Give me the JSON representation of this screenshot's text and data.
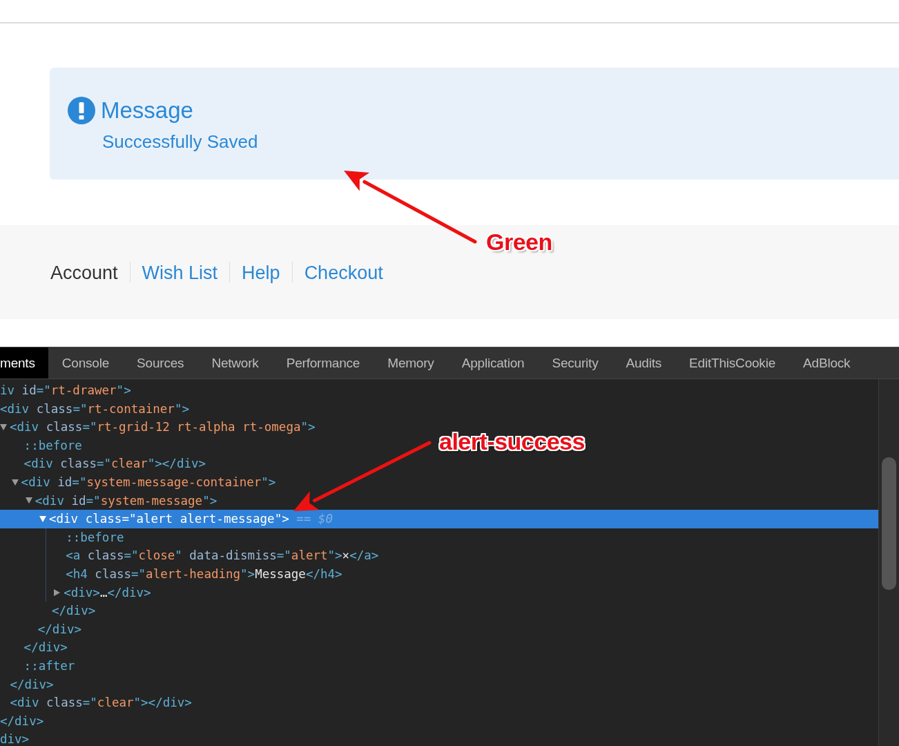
{
  "alert": {
    "heading": "Message",
    "body": "Successfully Saved"
  },
  "nav": [
    {
      "label": "Account",
      "kind": "plain"
    },
    {
      "label": "Wish List",
      "kind": "link"
    },
    {
      "label": "Help",
      "kind": "link"
    },
    {
      "label": "Checkout",
      "kind": "link"
    }
  ],
  "devtools": {
    "tabs": [
      {
        "label": "ments",
        "selected": true
      },
      {
        "label": "Console",
        "selected": false
      },
      {
        "label": "Sources",
        "selected": false
      },
      {
        "label": "Network",
        "selected": false
      },
      {
        "label": "Performance",
        "selected": false
      },
      {
        "label": "Memory",
        "selected": false
      },
      {
        "label": "Application",
        "selected": false
      },
      {
        "label": "Security",
        "selected": false
      },
      {
        "label": "Audits",
        "selected": false
      },
      {
        "label": "EditThisCookie",
        "selected": false
      },
      {
        "label": "AdBlock",
        "selected": false
      }
    ],
    "tree": [
      {
        "selected": false,
        "tokens": [
          {
            "kind": "tag",
            "text": "iv "
          },
          {
            "kind": "attr",
            "text": "id"
          },
          {
            "kind": "tag",
            "text": "=\""
          },
          {
            "kind": "value",
            "text": "rt-drawer"
          },
          {
            "kind": "tag",
            "text": "\">"
          }
        ],
        "close": [
          {
            "kind": "tag",
            "text": "div>"
          }
        ],
        "children": [
          {
            "selected": false,
            "tokens": [
              {
                "kind": "tag",
                "text": "<div "
              },
              {
                "kind": "attr",
                "text": "class"
              },
              {
                "kind": "tag",
                "text": "=\""
              },
              {
                "kind": "value",
                "text": "rt-container"
              },
              {
                "kind": "tag",
                "text": "\">"
              }
            ],
            "close": [
              {
                "kind": "tag",
                "text": "</div>"
              }
            ],
            "children": [
              {
                "selected": false,
                "expanded": true,
                "tokens": [
                  {
                    "kind": "tag",
                    "text": "<div "
                  },
                  {
                    "kind": "attr",
                    "text": "class"
                  },
                  {
                    "kind": "tag",
                    "text": "=\""
                  },
                  {
                    "kind": "value",
                    "text": "rt-grid-12 rt-alpha rt-omega"
                  },
                  {
                    "kind": "tag",
                    "text": "\">"
                  }
                ],
                "close": [
                  {
                    "kind": "tag",
                    "text": "</div>"
                  }
                ],
                "children": [
                  {
                    "selected": false,
                    "tokens": [
                      {
                        "kind": "tag",
                        "text": "::before"
                      }
                    ]
                  },
                  {
                    "selected": false,
                    "tokens": [
                      {
                        "kind": "tag",
                        "text": "<div "
                      },
                      {
                        "kind": "attr",
                        "text": "class"
                      },
                      {
                        "kind": "tag",
                        "text": "=\""
                      },
                      {
                        "kind": "value",
                        "text": "clear"
                      },
                      {
                        "kind": "tag",
                        "text": "\"></div>"
                      }
                    ]
                  },
                  {
                    "selected": false,
                    "expanded": true,
                    "tokens": [
                      {
                        "kind": "tag",
                        "text": "<div "
                      },
                      {
                        "kind": "attr",
                        "text": "id"
                      },
                      {
                        "kind": "tag",
                        "text": "=\""
                      },
                      {
                        "kind": "value",
                        "text": "system-message-container"
                      },
                      {
                        "kind": "tag",
                        "text": "\">"
                      }
                    ],
                    "close": [
                      {
                        "kind": "tag",
                        "text": "</div>"
                      }
                    ],
                    "children": [
                      {
                        "selected": false,
                        "expanded": true,
                        "tokens": [
                          {
                            "kind": "tag",
                            "text": "<div "
                          },
                          {
                            "kind": "attr",
                            "text": "id"
                          },
                          {
                            "kind": "tag",
                            "text": "=\""
                          },
                          {
                            "kind": "value",
                            "text": "system-message"
                          },
                          {
                            "kind": "tag",
                            "text": "\">"
                          }
                        ],
                        "close": [
                          {
                            "kind": "tag",
                            "text": "</div>"
                          }
                        ],
                        "children": [
                          {
                            "selected": true,
                            "expanded": true,
                            "tokens": [
                              {
                                "kind": "tag",
                                "text": "<div "
                              },
                              {
                                "kind": "attr",
                                "text": "class"
                              },
                              {
                                "kind": "tag",
                                "text": "=\""
                              },
                              {
                                "kind": "value",
                                "text": "alert alert-message"
                              },
                              {
                                "kind": "tag",
                                "text": "\">"
                              },
                              {
                                "kind": "dim",
                                "text": " == $0"
                              }
                            ],
                            "close": [
                              {
                                "kind": "tag",
                                "text": "</div>"
                              }
                            ],
                            "children": [
                              {
                                "selected": false,
                                "tokens": [
                                  {
                                    "kind": "tag",
                                    "text": "::before"
                                  }
                                ]
                              },
                              {
                                "selected": false,
                                "tokens": [
                                  {
                                    "kind": "tag",
                                    "text": "<a "
                                  },
                                  {
                                    "kind": "attr",
                                    "text": "class"
                                  },
                                  {
                                    "kind": "tag",
                                    "text": "=\""
                                  },
                                  {
                                    "kind": "value",
                                    "text": "close"
                                  },
                                  {
                                    "kind": "tag",
                                    "text": "\" "
                                  },
                                  {
                                    "kind": "attr",
                                    "text": "data-dismiss"
                                  },
                                  {
                                    "kind": "tag",
                                    "text": "=\""
                                  },
                                  {
                                    "kind": "value",
                                    "text": "alert"
                                  },
                                  {
                                    "kind": "tag",
                                    "text": "\">"
                                  },
                                  {
                                    "kind": "text",
                                    "text": "×"
                                  },
                                  {
                                    "kind": "tag",
                                    "text": "</a>"
                                  }
                                ]
                              },
                              {
                                "selected": false,
                                "tokens": [
                                  {
                                    "kind": "tag",
                                    "text": "<h4 "
                                  },
                                  {
                                    "kind": "attr",
                                    "text": "class"
                                  },
                                  {
                                    "kind": "tag",
                                    "text": "=\""
                                  },
                                  {
                                    "kind": "value",
                                    "text": "alert-heading"
                                  },
                                  {
                                    "kind": "tag",
                                    "text": "\">"
                                  },
                                  {
                                    "kind": "text",
                                    "text": "Message"
                                  },
                                  {
                                    "kind": "tag",
                                    "text": "</h4>"
                                  }
                                ]
                              },
                              {
                                "selected": false,
                                "expanded": false,
                                "tokens": [
                                  {
                                    "kind": "tag",
                                    "text": "<div>"
                                  },
                                  {
                                    "kind": "text",
                                    "text": "…"
                                  },
                                  {
                                    "kind": "tag",
                                    "text": "</div>"
                                  }
                                ]
                              }
                            ]
                          }
                        ]
                      }
                    ]
                  },
                  {
                    "selected": false,
                    "tokens": [
                      {
                        "kind": "tag",
                        "text": "::after"
                      }
                    ]
                  }
                ]
              },
              {
                "selected": false,
                "tokens": [
                  {
                    "kind": "tag",
                    "text": "<div "
                  },
                  {
                    "kind": "attr",
                    "text": "class"
                  },
                  {
                    "kind": "tag",
                    "text": "=\""
                  },
                  {
                    "kind": "value",
                    "text": "clear"
                  },
                  {
                    "kind": "tag",
                    "text": "\"></div>"
                  }
                ]
              }
            ]
          }
        ]
      }
    ]
  },
  "annotations": [
    {
      "text": "Green"
    },
    {
      "text": "alert-success"
    }
  ]
}
